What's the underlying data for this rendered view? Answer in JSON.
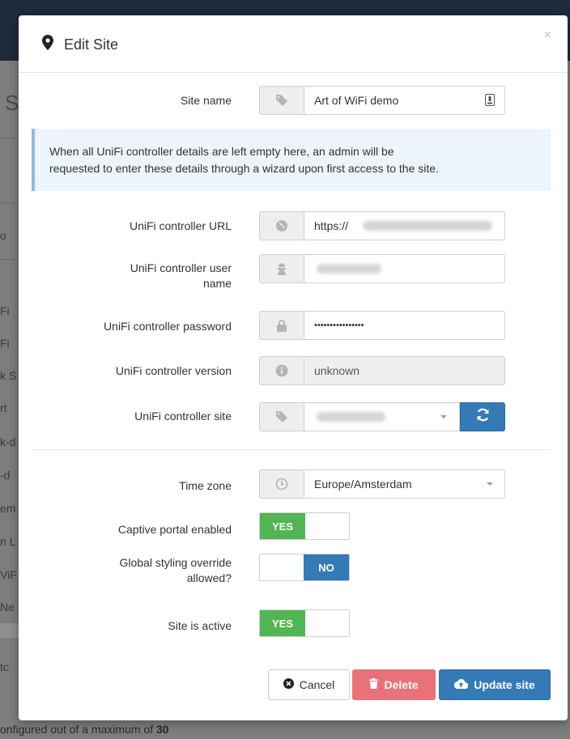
{
  "background": {
    "heading_fragment": "S",
    "list_fragments": [
      "o",
      "Fi",
      "Fi",
      "k S",
      "rt",
      "k-d",
      "-d",
      "em",
      "n L",
      "ViF",
      "Ne"
    ],
    "footer_text": "onfigured out of a maximum of ",
    "footer_count": "30",
    "side_fragment": "tc"
  },
  "modal": {
    "title": "Edit Site",
    "title_icon": "map-marker-icon",
    "close_glyph": "×",
    "site_name": {
      "label": "Site name",
      "value": "Art of WiFi demo",
      "icon": "tag-icon"
    },
    "info_text_line1": "When all UniFi controller details are left empty here, an admin will be",
    "info_text_line2": "requested to enter these details through a wizard upon first access to the site.",
    "controller_url": {
      "label": "UniFi controller URL",
      "value": "https://",
      "icon": "globe-icon"
    },
    "controller_user": {
      "label_line1": "UniFi controller user",
      "label_line2": "name",
      "icon": "user-secret-icon"
    },
    "controller_password": {
      "label": "UniFi controller password",
      "value": "••••••••••••••••",
      "icon": "lock-icon"
    },
    "controller_version": {
      "label": "UniFi controller version",
      "value": "unknown",
      "icon": "info-circle-icon"
    },
    "controller_site": {
      "label": "UniFi controller site",
      "icon": "tag-icon"
    },
    "time_zone": {
      "label": "Time zone",
      "value": "Europe/Amsterdam",
      "icon": "clock-icon"
    },
    "captive_portal": {
      "label": "Captive portal enabled",
      "state": "YES"
    },
    "global_styling": {
      "label_line1": "Global styling override",
      "label_line2": "allowed?",
      "state": "NO"
    },
    "site_active": {
      "label": "Site is active",
      "state": "YES"
    },
    "buttons": {
      "cancel": "Cancel",
      "delete": "Delete",
      "update": "Update site"
    }
  },
  "colors": {
    "primary": "#337ab7",
    "success": "#52b553",
    "danger": "#e9717a",
    "info_bg": "#eef4fb"
  }
}
